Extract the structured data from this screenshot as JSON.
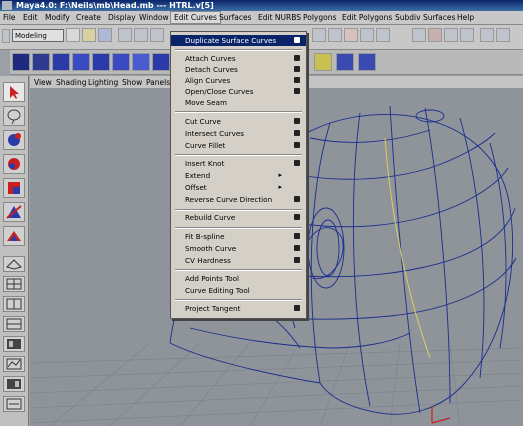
{
  "window": {
    "title": "Maya4.0: F:\\Neils\\mb\\Head.mb  ---  HTRL.v[5]"
  },
  "menubar": [
    "File",
    "Edit",
    "Modify",
    "Create",
    "Display",
    "Window",
    "Edit Curves",
    "Surfaces",
    "Edit NURBS",
    "Polygons",
    "Edit Polygons",
    "Subdiv Surfaces",
    "Help"
  ],
  "status": {
    "mode": "Modeling"
  },
  "panel_menu": [
    "View",
    "Shading",
    "Lighting",
    "Show",
    "Panels"
  ],
  "dropdown": {
    "items": [
      {
        "label": "Duplicate Surface Curves",
        "option": true,
        "selected": true
      },
      {
        "label": "Attach Curves",
        "option": true
      },
      {
        "label": "Detach Curves",
        "option": true
      },
      {
        "label": "Align Curves",
        "option": true
      },
      {
        "label": "Open/Close Curves",
        "option": true
      },
      {
        "label": "Move Seam",
        "option": false
      },
      {
        "label": "Cut Curve",
        "option": true
      },
      {
        "label": "Intersect Curves",
        "option": true
      },
      {
        "label": "Curve Fillet",
        "option": true
      },
      {
        "label": "Insert Knot",
        "option": true
      },
      {
        "label": "Extend",
        "option": false,
        "submenu": true
      },
      {
        "label": "Offset",
        "option": false,
        "submenu": true
      },
      {
        "label": "Reverse Curve Direction",
        "option": true
      },
      {
        "label": "Rebuild Curve",
        "option": true
      },
      {
        "label": "Fit B-spline",
        "option": true
      },
      {
        "label": "Smooth Curve",
        "option": true
      },
      {
        "label": "CV Hardness",
        "option": true
      },
      {
        "label": "Add Points Tool",
        "option": false
      },
      {
        "label": "Curve Editing Tool",
        "option": false
      },
      {
        "label": "Project Tangent",
        "option": true
      }
    ],
    "submenu_glyph": "▸"
  },
  "colors": {
    "title_bg": "#0a246a",
    "menu_bg": "#d4d0c8",
    "highlight": "#0a246a",
    "wire": "#1c2d8c",
    "viewport": "#8e949a"
  },
  "icons": [
    "select-arrow-icon",
    "lasso-icon",
    "move-icon",
    "rotate-icon",
    "scale-icon",
    "show-manipulator-icon",
    "four-panel-icon",
    "render-icon",
    "save-icon",
    "snap-icon"
  ]
}
